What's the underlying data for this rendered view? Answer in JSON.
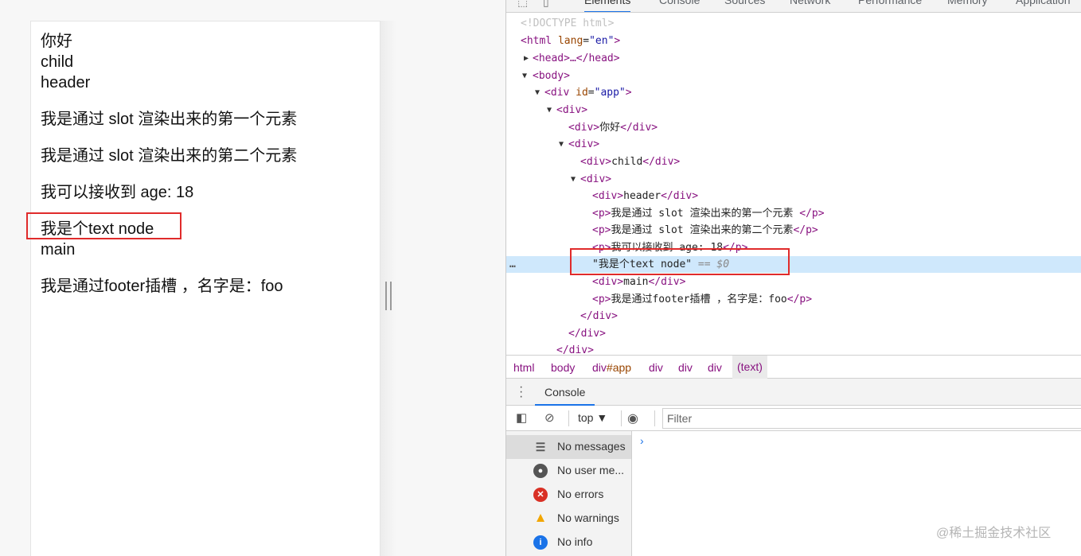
{
  "page": {
    "lines": [
      "你好",
      "child",
      "header"
    ],
    "paragraphs": [
      "我是通过 slot 渲染出来的第一个元素",
      "我是通过 slot 渲染出来的第二个元素",
      "我可以接收到 age: 18"
    ],
    "text_node": "我是个text node",
    "main": "main",
    "footer_text": "我是通过footer插槽 ，名字是：foo"
  },
  "devtools": {
    "tabs": [
      "Elements",
      "Console",
      "Sources",
      "Network",
      "Performance",
      "Memory",
      "Application"
    ],
    "active_tab": "Elements",
    "tree": {
      "doctype": "<!DOCTYPE html>",
      "html_open": "<html",
      "html_attr": "lang",
      "html_val": "\"en\"",
      "head": "<head>…</head>",
      "body": "<body>",
      "app_open": "<div",
      "app_attr": "id",
      "app_val": "\"app\"",
      "div_open": "<div>",
      "div_close": "</div>",
      "p_open": "<p>",
      "p_close": "</p>",
      "nihao": "你好",
      "child": "child",
      "header": "header",
      "p1": "我是通过 slot 渲染出来的第一个元素 ",
      "p2": "我是通过 slot 渲染出来的第二个元素",
      "p3": "我可以接收到 age: 18",
      "textnode": "\"我是个text node\"",
      "eq": "== $0",
      "main": "main",
      "footer": "我是通过footer插槽 ，名字是：foo",
      "dots": "…"
    },
    "breadcrumbs": [
      "html",
      "body",
      "div",
      "#app",
      "div",
      "div",
      "div",
      "(text)"
    ],
    "drawer_tab": "Console",
    "context": "top",
    "filter_placeholder": "Filter",
    "sidebar": [
      {
        "label": "No messages",
        "icon": "list-icon"
      },
      {
        "label": "No user me...",
        "icon": "user-icon"
      },
      {
        "label": "No errors",
        "icon": "error-icon",
        "color": "#d93025"
      },
      {
        "label": "No warnings",
        "icon": "warning-icon",
        "color": "#f2a600"
      },
      {
        "label": "No info",
        "icon": "info-icon",
        "color": "#1a73e8"
      }
    ],
    "prompt": "›"
  },
  "watermark": "@稀土掘金技术社区"
}
